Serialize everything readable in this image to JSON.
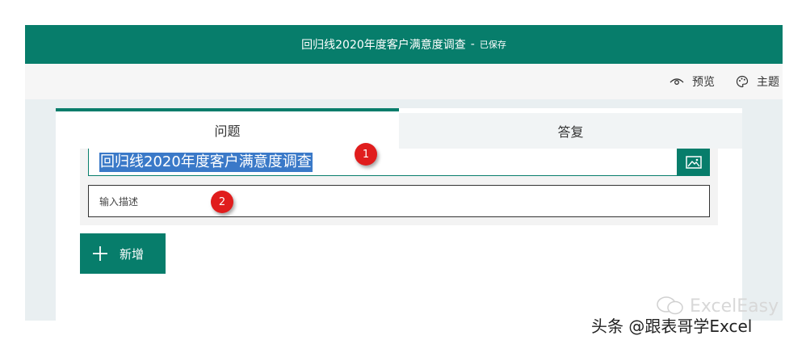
{
  "header": {
    "title": "回归线2020年度客户满意度调查",
    "separator": "-",
    "status": "已保存",
    "bg_color": "#077d6b"
  },
  "toolbar": {
    "preview_label": "预览",
    "preview_icon": "eye-icon",
    "theme_label": "主题",
    "theme_icon": "palette-icon"
  },
  "tabs": [
    {
      "label": "问题",
      "active": true
    },
    {
      "label": "答复",
      "active": false
    }
  ],
  "form": {
    "title_value": "回归线2020年度客户满意度调查",
    "title_selected": true,
    "image_button_icon": "image-icon",
    "description_placeholder": "输入描述"
  },
  "add_button": {
    "label": "新增",
    "icon": "plus-icon"
  },
  "markers": [
    "1",
    "2"
  ],
  "watermarks": {
    "brand": "ExcelEasy",
    "credit": "头条 @跟表哥学Excel"
  }
}
